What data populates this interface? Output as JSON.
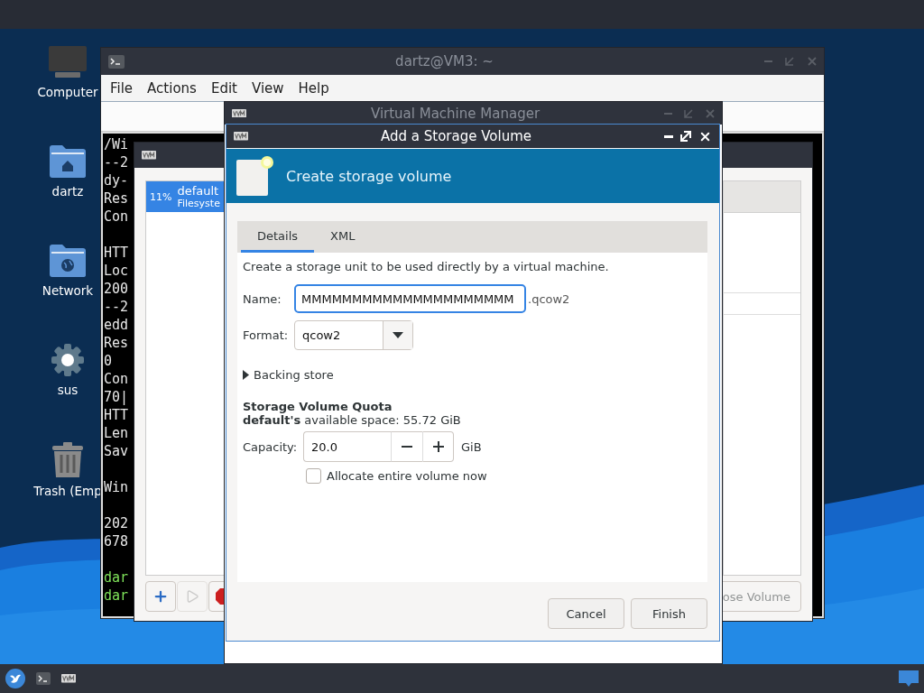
{
  "desktop_icons": [
    {
      "kind": "computer",
      "label": "Computer"
    },
    {
      "kind": "home",
      "label": "dartz"
    },
    {
      "kind": "network",
      "label": "Network"
    },
    {
      "kind": "settings",
      "label": "sus"
    },
    {
      "kind": "trash",
      "label": "Trash (Emp"
    }
  ],
  "terminal": {
    "title": "dartz@VM3: ~",
    "menu": [
      "File",
      "Actions",
      "Edit",
      "View",
      "Help"
    ],
    "lines": [
      {
        "kind": "output",
        "text": "/Wi"
      },
      {
        "kind": "output",
        "text": "--2"
      },
      {
        "kind": "output",
        "text": "dy-"
      },
      {
        "kind": "output",
        "text": "Res"
      },
      {
        "kind": "output",
        "text": "Con"
      },
      {
        "kind": "blank"
      },
      {
        "kind": "output",
        "text": "HTT"
      },
      {
        "kind": "output",
        "text": "Loc"
      },
      {
        "kind": "output",
        "text": "200"
      },
      {
        "kind": "output",
        "text": "--2"
      },
      {
        "kind": "output",
        "text": "edd"
      },
      {
        "kind": "output",
        "text": "Res"
      },
      {
        "kind": "output",
        "text": "0"
      },
      {
        "kind": "output",
        "text": "Con"
      },
      {
        "kind": "output",
        "text": "70|"
      },
      {
        "kind": "output",
        "text": "HTT"
      },
      {
        "kind": "output",
        "text": "Len"
      },
      {
        "kind": "output",
        "text": "Sav"
      },
      {
        "kind": "blank"
      },
      {
        "kind": "output",
        "text": "Win"
      },
      {
        "kind": "blank"
      },
      {
        "kind": "output",
        "text": "202"
      },
      {
        "kind": "output",
        "text": "678"
      },
      {
        "kind": "blank"
      },
      {
        "kind": "prompt",
        "text": "dar"
      },
      {
        "kind": "prompt",
        "text": "dar"
      }
    ]
  },
  "storage_window": {
    "pools": [
      {
        "usage": "11%",
        "name": "default",
        "type": "Filesyste",
        "selected": true
      }
    ],
    "toolbar": [
      {
        "kind": "add",
        "disabled": false
      },
      {
        "kind": "start",
        "disabled": true
      },
      {
        "kind": "stop",
        "disabled": false
      }
    ],
    "volume_button": {
      "label": "ose Volume",
      "disabled": true
    }
  },
  "vmm_window": {
    "title": "Virtual Machine Manager"
  },
  "dialog": {
    "title": "Add a Storage Volume",
    "banner": "Create storage volume",
    "tabs": [
      {
        "label": "Details",
        "selected": true
      },
      {
        "label": "XML",
        "selected": false
      }
    ],
    "intro": "Create a storage unit to be used directly by a virtual machine.",
    "name": {
      "label": "Name:",
      "value": "MMMMMMMMMMMMMMMMMMMMM",
      "suffix": ".qcow2"
    },
    "format": {
      "label": "Format:",
      "value": "qcow2"
    },
    "backing_store": {
      "label": "Backing store",
      "expanded": false
    },
    "quota": {
      "heading": "Storage Volume Quota",
      "available": "**default's** available space: 55.72 GiB"
    },
    "capacity": {
      "label": "Capacity:",
      "value": "20.0",
      "unit": "GiB"
    },
    "allocate": {
      "label": "Allocate entire volume now",
      "checked": false
    },
    "buttons": [
      "Cancel",
      "Finish"
    ]
  }
}
